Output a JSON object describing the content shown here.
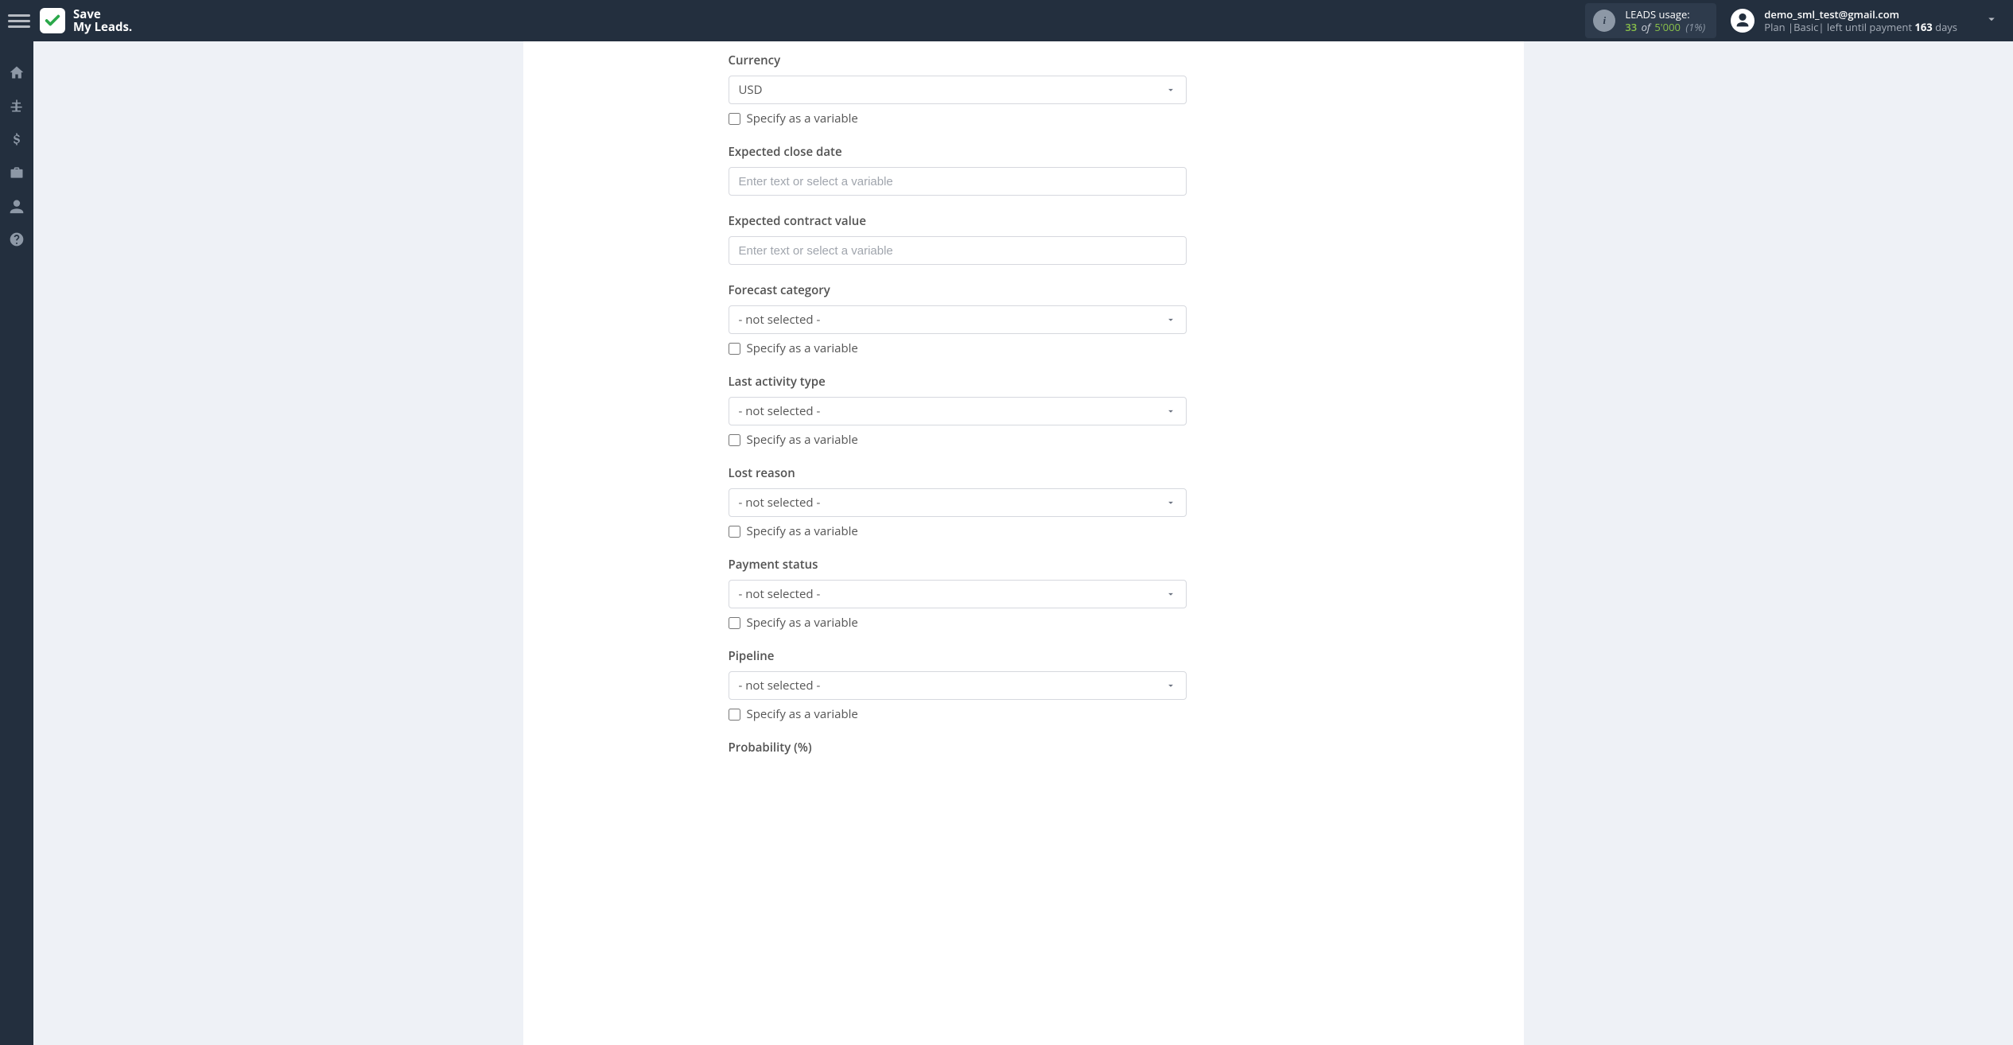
{
  "brand": {
    "line1": "Save",
    "line2": "My Leads."
  },
  "usage": {
    "label": "LEADS usage:",
    "used": "33",
    "of_word": "of",
    "total": "5'000",
    "pct": "(1%)"
  },
  "account": {
    "email": "demo_sml_test@gmail.com",
    "plan_prefix": "Plan |",
    "plan_name": "Basic",
    "plan_mid": "| left until payment ",
    "days_value": "163",
    "days_suffix": " days"
  },
  "placeholders": {
    "text_variable": "Enter text or select a variable",
    "not_selected": "- not selected -"
  },
  "labels": {
    "specify_variable": "Specify as a variable"
  },
  "fields": {
    "currency": {
      "label": "Currency",
      "value": "USD"
    },
    "expected_close_date": {
      "label": "Expected close date"
    },
    "expected_contract_value": {
      "label": "Expected contract value"
    },
    "forecast_category": {
      "label": "Forecast category"
    },
    "last_activity_type": {
      "label": "Last activity type"
    },
    "lost_reason": {
      "label": "Lost reason"
    },
    "payment_status": {
      "label": "Payment status"
    },
    "pipeline": {
      "label": "Pipeline"
    },
    "probability": {
      "label": "Probability (%)"
    }
  }
}
